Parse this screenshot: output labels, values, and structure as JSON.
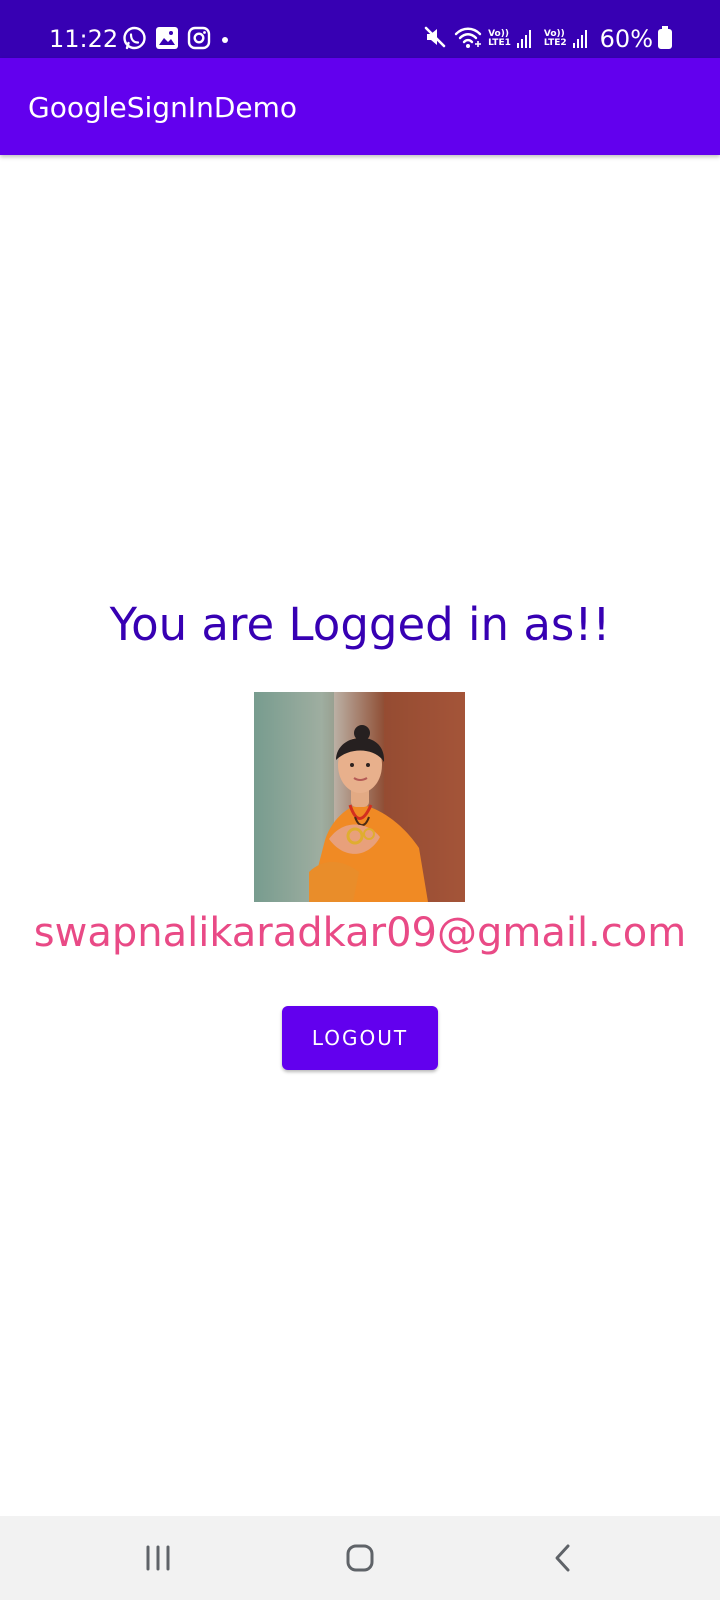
{
  "status_bar": {
    "time": "11:22",
    "left_icons": [
      "whatsapp-icon",
      "gallery-icon",
      "instagram-icon",
      "notification-dot-icon"
    ],
    "right_icons": [
      "mute-icon",
      "wifi-icon",
      "volte-lte1-icon",
      "signal-icon",
      "volte-lte2-icon",
      "signal-icon",
      "battery-charging-icon"
    ],
    "lte1_top": "Vo))",
    "lte1_bottom": "LTE1",
    "lte2_top": "Vo))",
    "lte2_bottom": "LTE2",
    "battery": "60%",
    "background": "#3700b3"
  },
  "app_bar": {
    "title": "GoogleSignInDemo",
    "background": "#6200ee"
  },
  "main": {
    "headline": "You are Logged in as!!",
    "email": "swapnalikaradkar09@gmail.com",
    "logout_label": "LOGOUT",
    "headline_color": "#3700b3",
    "email_color": "#e94a86",
    "button_color": "#6200ee"
  },
  "nav_bar": {
    "buttons": [
      "recent-apps-icon",
      "home-icon",
      "back-icon"
    ]
  }
}
